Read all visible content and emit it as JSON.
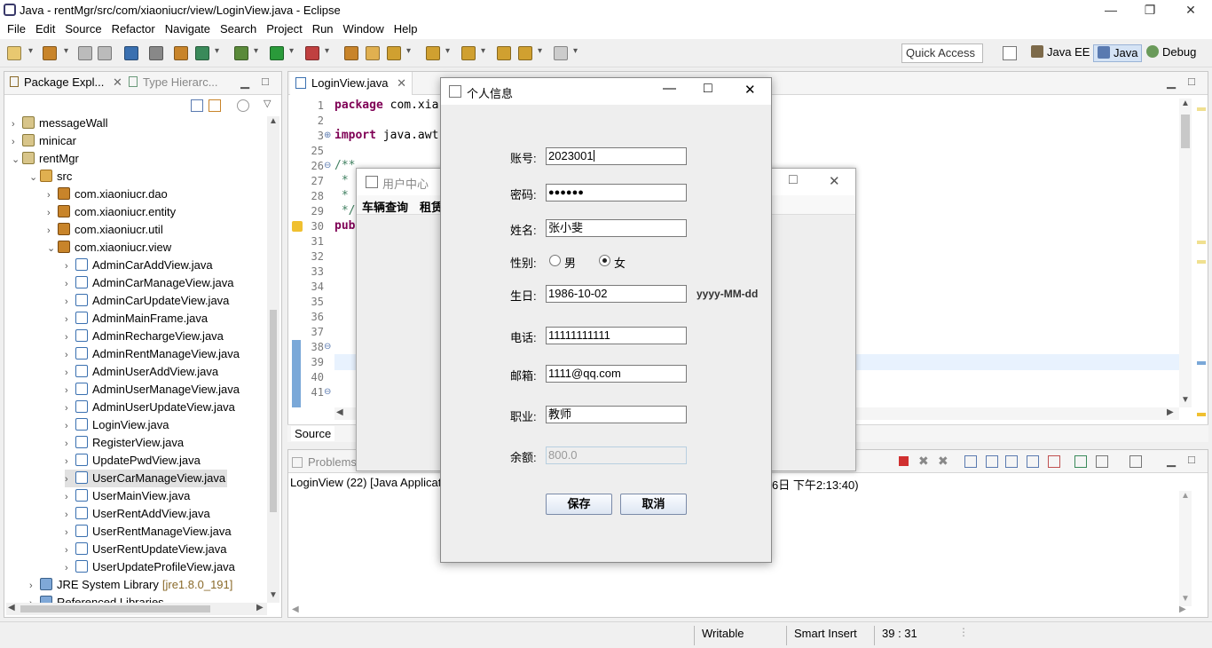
{
  "window": {
    "title": "Java - rentMgr/src/com/xiaoniucr/view/LoginView.java - Eclipse"
  },
  "menu": [
    "File",
    "Edit",
    "Source",
    "Refactor",
    "Navigate",
    "Search",
    "Project",
    "Run",
    "Window",
    "Help"
  ],
  "toolbar": {
    "quick_access": "Quick Access",
    "perspectives": [
      "Java EE",
      "Java",
      "Debug"
    ]
  },
  "package_explorer": {
    "tab_active": "Package Expl...",
    "tab_other": "Type Hierarc...",
    "tree": [
      {
        "label": "messageWall",
        "icon": "project-icon",
        "depth": 0,
        "expanded": false
      },
      {
        "label": "minicar",
        "icon": "project-icon",
        "depth": 0,
        "expanded": false
      },
      {
        "label": "rentMgr",
        "icon": "project-icon",
        "depth": 0,
        "expanded": true
      },
      {
        "label": "src",
        "icon": "source-folder-icon",
        "depth": 1,
        "expanded": true
      },
      {
        "label": "com.xiaoniucr.dao",
        "icon": "package-icon",
        "depth": 2,
        "expanded": false
      },
      {
        "label": "com.xiaoniucr.entity",
        "icon": "package-icon",
        "depth": 2,
        "expanded": false
      },
      {
        "label": "com.xiaoniucr.util",
        "icon": "package-icon",
        "depth": 2,
        "expanded": false
      },
      {
        "label": "com.xiaoniucr.view",
        "icon": "package-icon",
        "depth": 2,
        "expanded": true
      },
      {
        "label": "AdminCarAddView.java",
        "icon": "java-file-icon",
        "depth": 3,
        "expanded": false
      },
      {
        "label": "AdminCarManageView.java",
        "icon": "java-file-icon",
        "depth": 3,
        "expanded": false
      },
      {
        "label": "AdminCarUpdateView.java",
        "icon": "java-file-icon",
        "depth": 3,
        "expanded": false
      },
      {
        "label": "AdminMainFrame.java",
        "icon": "java-file-icon",
        "depth": 3,
        "expanded": false
      },
      {
        "label": "AdminRechargeView.java",
        "icon": "java-file-icon",
        "depth": 3,
        "expanded": false
      },
      {
        "label": "AdminRentManageView.java",
        "icon": "java-file-icon",
        "depth": 3,
        "expanded": false
      },
      {
        "label": "AdminUserAddView.java",
        "icon": "java-file-icon",
        "depth": 3,
        "expanded": false
      },
      {
        "label": "AdminUserManageView.java",
        "icon": "java-file-icon",
        "depth": 3,
        "expanded": false
      },
      {
        "label": "AdminUserUpdateView.java",
        "icon": "java-file-icon",
        "depth": 3,
        "expanded": false
      },
      {
        "label": "LoginView.java",
        "icon": "java-file-icon",
        "depth": 3,
        "expanded": false
      },
      {
        "label": "RegisterView.java",
        "icon": "java-file-icon",
        "depth": 3,
        "expanded": false
      },
      {
        "label": "UpdatePwdView.java",
        "icon": "java-file-icon",
        "depth": 3,
        "expanded": false
      },
      {
        "label": "UserCarManageView.java",
        "icon": "java-file-icon",
        "depth": 3,
        "expanded": false,
        "selected": true
      },
      {
        "label": "UserMainView.java",
        "icon": "java-file-icon",
        "depth": 3,
        "expanded": false
      },
      {
        "label": "UserRentAddView.java",
        "icon": "java-file-icon",
        "depth": 3,
        "expanded": false
      },
      {
        "label": "UserRentManageView.java",
        "icon": "java-file-icon",
        "depth": 3,
        "expanded": false
      },
      {
        "label": "UserRentUpdateView.java",
        "icon": "java-file-icon",
        "depth": 3,
        "expanded": false
      },
      {
        "label": "UserUpdateProfileView.java",
        "icon": "java-file-icon",
        "depth": 3,
        "expanded": false
      },
      {
        "label": "JRE System Library",
        "suffix": "[jre1.8.0_191]",
        "icon": "library-icon",
        "depth": 1,
        "expanded": false
      },
      {
        "label": "Referenced Libraries",
        "icon": "library-icon",
        "depth": 1,
        "expanded": false
      }
    ]
  },
  "editor": {
    "tab": "LoginView.java",
    "lines": [
      {
        "num": "1",
        "code": "package com.xia",
        "kind": "pkg"
      },
      {
        "num": "2",
        "code": "",
        "kind": "plain"
      },
      {
        "num": "3",
        "code": "import java.awt",
        "kind": "imp"
      },
      {
        "num": "25",
        "code": "",
        "kind": "plain"
      },
      {
        "num": "26",
        "code": "/**",
        "kind": "cm"
      },
      {
        "num": "27",
        "code": " * ",
        "kind": "cm"
      },
      {
        "num": "28",
        "code": " * ",
        "kind": "cm"
      },
      {
        "num": "29",
        "code": " */",
        "kind": "cm"
      },
      {
        "num": "30",
        "code": "pub",
        "kind": "kwline"
      },
      {
        "num": "31",
        "code": "",
        "kind": "plain"
      },
      {
        "num": "32",
        "code": "",
        "kind": "plain"
      },
      {
        "num": "33",
        "code": "",
        "kind": "plain"
      },
      {
        "num": "34",
        "code": "",
        "kind": "plain"
      },
      {
        "num": "35",
        "code": "",
        "kind": "plain"
      },
      {
        "num": "36",
        "code": "",
        "kind": "plain"
      },
      {
        "num": "37",
        "code": "",
        "kind": "plain"
      },
      {
        "num": "38",
        "code": "",
        "kind": "plain"
      },
      {
        "num": "39",
        "code": "",
        "kind": "plain"
      },
      {
        "num": "40",
        "code": "",
        "kind": "plain"
      },
      {
        "num": "41",
        "code": "",
        "kind": "plain"
      }
    ],
    "source_tab": "Source"
  },
  "console": {
    "tab": "Problems",
    "line_left": "LoginView (22) [Java Applicati",
    "line_right": "6日 下午2:13:40)"
  },
  "status": {
    "writable": "Writable",
    "insert_mode": "Smart Insert",
    "position": "39 : 31"
  },
  "user_center": {
    "title": "用户中心",
    "menu": [
      "车辆查询",
      "租赁"
    ]
  },
  "dialog": {
    "title": "个人信息",
    "account_label": "账号:",
    "account_value": "2023001",
    "password_label": "密码:",
    "password_value": "●●●●●●",
    "name_label": "姓名:",
    "name_value": "张小斐",
    "gender_label": "性别:",
    "gender_male": "男",
    "gender_female": "女",
    "gender_selected": "女",
    "birthday_label": "生日:",
    "birthday_value": "1986-10-02",
    "birthday_format": "yyyy-MM-dd",
    "phone_label": "电话:",
    "phone_value": "11111111111",
    "email_label": "邮箱:",
    "email_value": "1111@qq.com",
    "job_label": "职业:",
    "job_value": "教师",
    "balance_label": "余额:",
    "balance_value": "800.0",
    "save_label": "保存",
    "cancel_label": "取消"
  }
}
